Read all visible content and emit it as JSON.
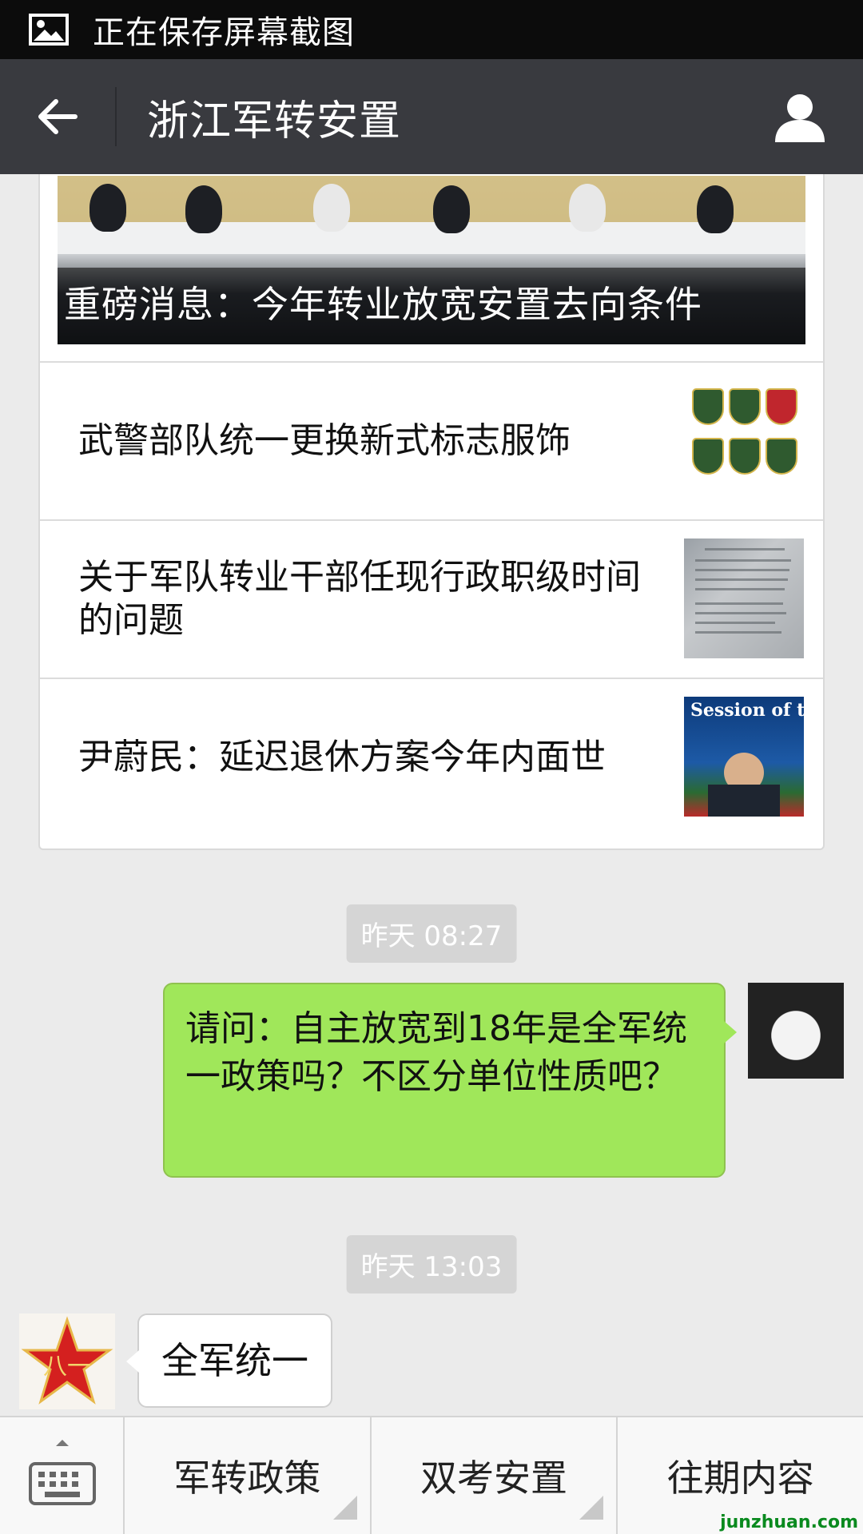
{
  "status_bar": {
    "text": "正在保存屏幕截图",
    "icon": "image-icon"
  },
  "nav": {
    "title": "浙江军转安置",
    "back_icon": "back-arrow-icon",
    "profile_icon": "person-icon"
  },
  "articles": {
    "hero": {
      "title": "重磅消息：今年转业放宽安置去向条件"
    },
    "items": [
      {
        "title": "武警部队统一更换新式标志服饰",
        "thumb": "insignia-badges"
      },
      {
        "title": "关于军队转业干部任现行政职级时间的问题",
        "thumb": "document-photo"
      },
      {
        "title": "尹蔚民：延迟退休方案今年内面世",
        "thumb": "press-conference-photo",
        "thumb_text": "Session of the"
      }
    ]
  },
  "messages": [
    {
      "time": "昨天 08:27",
      "direction": "sent",
      "text": "请问：自主放宽到18年是全军统一政策吗？不区分单位性质吧？",
      "avatar": "panda-avatar"
    },
    {
      "time": "昨天 13:03",
      "direction": "received",
      "text": "全军统一",
      "avatar": "red-star-avatar",
      "avatar_text": "八一"
    }
  ],
  "menu": {
    "keyboard_icon": "keyboard-icon",
    "items": [
      {
        "label": "军转政策",
        "has_submenu": true
      },
      {
        "label": "双考安置",
        "has_submenu": true
      },
      {
        "label": "往期内容",
        "has_submenu": false
      }
    ]
  },
  "watermark": "junzhuan.com",
  "colors": {
    "sent_bubble": "#a0e75a",
    "nav_bg": "#393a3f",
    "status_bg": "#0c0c0c",
    "chat_bg": "#ebebeb"
  }
}
